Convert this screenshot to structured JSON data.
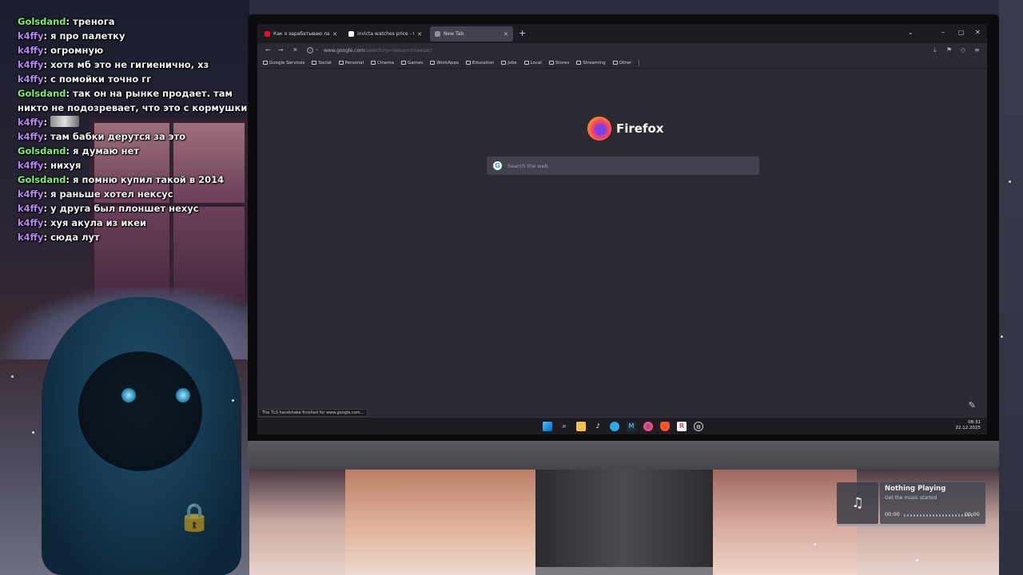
{
  "chat": {
    "messages": [
      {
        "user": "Golsdand",
        "user_color": "#7ff06a",
        "text": "тренога"
      },
      {
        "user": "k4ffy",
        "user_color": "#b685f2",
        "text": "я про палетку"
      },
      {
        "user": "k4ffy",
        "user_color": "#b685f2",
        "text": "огромную"
      },
      {
        "user": "k4ffy",
        "user_color": "#b685f2",
        "text": "хотя мб это не гигиенично, хз"
      },
      {
        "user": "k4ffy",
        "user_color": "#b685f2",
        "text": "с помойки точно гг"
      },
      {
        "user": "Golsdand",
        "user_color": "#7ff06a",
        "text": "так он на рынке продает. там никто не подозревает, что это с кормушки"
      },
      {
        "user": "k4ffy",
        "user_color": "#b685f2",
        "text": ""
      },
      {
        "user": "k4ffy",
        "user_color": "#b685f2",
        "text": "там бабки дерутся за это"
      },
      {
        "user": "Golsdand",
        "user_color": "#7ff06a",
        "text": "я думаю нет"
      },
      {
        "user": "k4ffy",
        "user_color": "#b685f2",
        "text": "нихуя"
      },
      {
        "user": "Golsdand",
        "user_color": "#7ff06a",
        "text": "я помню купил такой в 2014"
      },
      {
        "user": "k4ffy",
        "user_color": "#b685f2",
        "text": "я раньше хотел нексус"
      },
      {
        "user": "k4ffy",
        "user_color": "#b685f2",
        "text": "у друга был плоншет нехус"
      },
      {
        "user": "k4ffy",
        "user_color": "#b685f2",
        "text": "хуя акула из икеи"
      },
      {
        "user": "k4ffy",
        "user_color": "#b685f2",
        "text": "сюда лут"
      }
    ],
    "emote_name": "emote-image"
  },
  "browser": {
    "tabs": [
      {
        "title": "Как я зарабатываю лазая по м",
        "favicon_color": "#ff0033",
        "active": false
      },
      {
        "title": "invicta watches price - Google",
        "favicon_color": "#ffffff",
        "active": false
      },
      {
        "title": "New Tab",
        "favicon_color": "#8f8f9d",
        "active": true
      }
    ],
    "url_host": "www.google.com",
    "url_path": "/search?q=nexus+планшет",
    "bookmarks": [
      "Google Services",
      "Social",
      "Personal",
      "Cinema",
      "Games",
      "WorkApps",
      "Education",
      "Jobs",
      "Local",
      "Stores",
      "Streaming",
      "Other"
    ],
    "brand_name": "Firefox",
    "search_placeholder": "Search the web",
    "status_text": "The TLS handshake finished for www.google.com..."
  },
  "taskbar": {
    "time": "08:31",
    "date": "22.12.2025"
  },
  "music": {
    "title": "Nothing Playing",
    "subtitle": "Get the music started",
    "time_elapsed": "00:00",
    "time_total": "00:00"
  },
  "colors": {
    "k4ffy": "#b685f2",
    "golsdand": "#7ff06a",
    "browser_bg": "#2b2a33",
    "tab_active": "#42414d"
  }
}
